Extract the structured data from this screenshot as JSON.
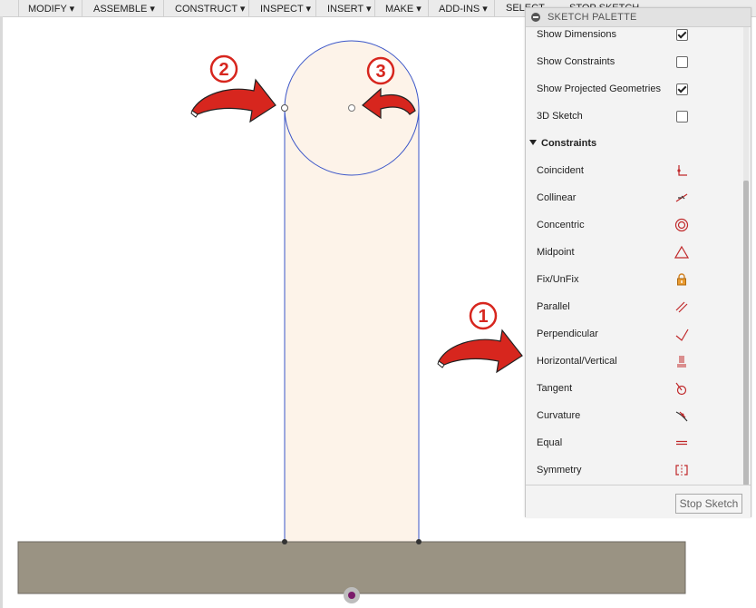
{
  "toolbar": {
    "items": [
      "MODIFY ▾",
      "ASSEMBLE ▾",
      "CONSTRUCT ▾",
      "INSPECT ▾",
      "INSERT ▾",
      "MAKE ▾",
      "ADD-INS ▾",
      "SELECT",
      "STOP SKETCH"
    ]
  },
  "palette": {
    "title": "SKETCH PALETTE",
    "options": [
      {
        "label": "Show Dimensions",
        "checked": true
      },
      {
        "label": "Show Constraints",
        "checked": false
      },
      {
        "label": "Show Projected Geometries",
        "checked": true
      },
      {
        "label": "3D Sketch",
        "checked": false
      }
    ],
    "constraints_title": "Constraints",
    "constraints": [
      {
        "label": "Coincident",
        "icon": "coincident-icon"
      },
      {
        "label": "Collinear",
        "icon": "collinear-icon"
      },
      {
        "label": "Concentric",
        "icon": "concentric-icon"
      },
      {
        "label": "Midpoint",
        "icon": "midpoint-icon"
      },
      {
        "label": "Fix/UnFix",
        "icon": "lock-icon"
      },
      {
        "label": "Parallel",
        "icon": "parallel-icon"
      },
      {
        "label": "Perpendicular",
        "icon": "perpendicular-icon"
      },
      {
        "label": "Horizontal/Vertical",
        "icon": "horizontal-vertical-icon"
      },
      {
        "label": "Tangent",
        "icon": "tangent-icon"
      },
      {
        "label": "Curvature",
        "icon": "curvature-icon"
      },
      {
        "label": "Equal",
        "icon": "equal-icon"
      },
      {
        "label": "Symmetry",
        "icon": "symmetry-icon"
      }
    ],
    "stop_label": "Stop Sketch"
  },
  "annotations": {
    "badges": [
      "1",
      "2",
      "3"
    ]
  },
  "colors": {
    "sketch_line": "#3a55c8",
    "profile_fill": "#fdf3e9",
    "body_fill": "#9a9383",
    "arrow_red": "#d7261e",
    "constraint_icon": "#c0282a"
  }
}
